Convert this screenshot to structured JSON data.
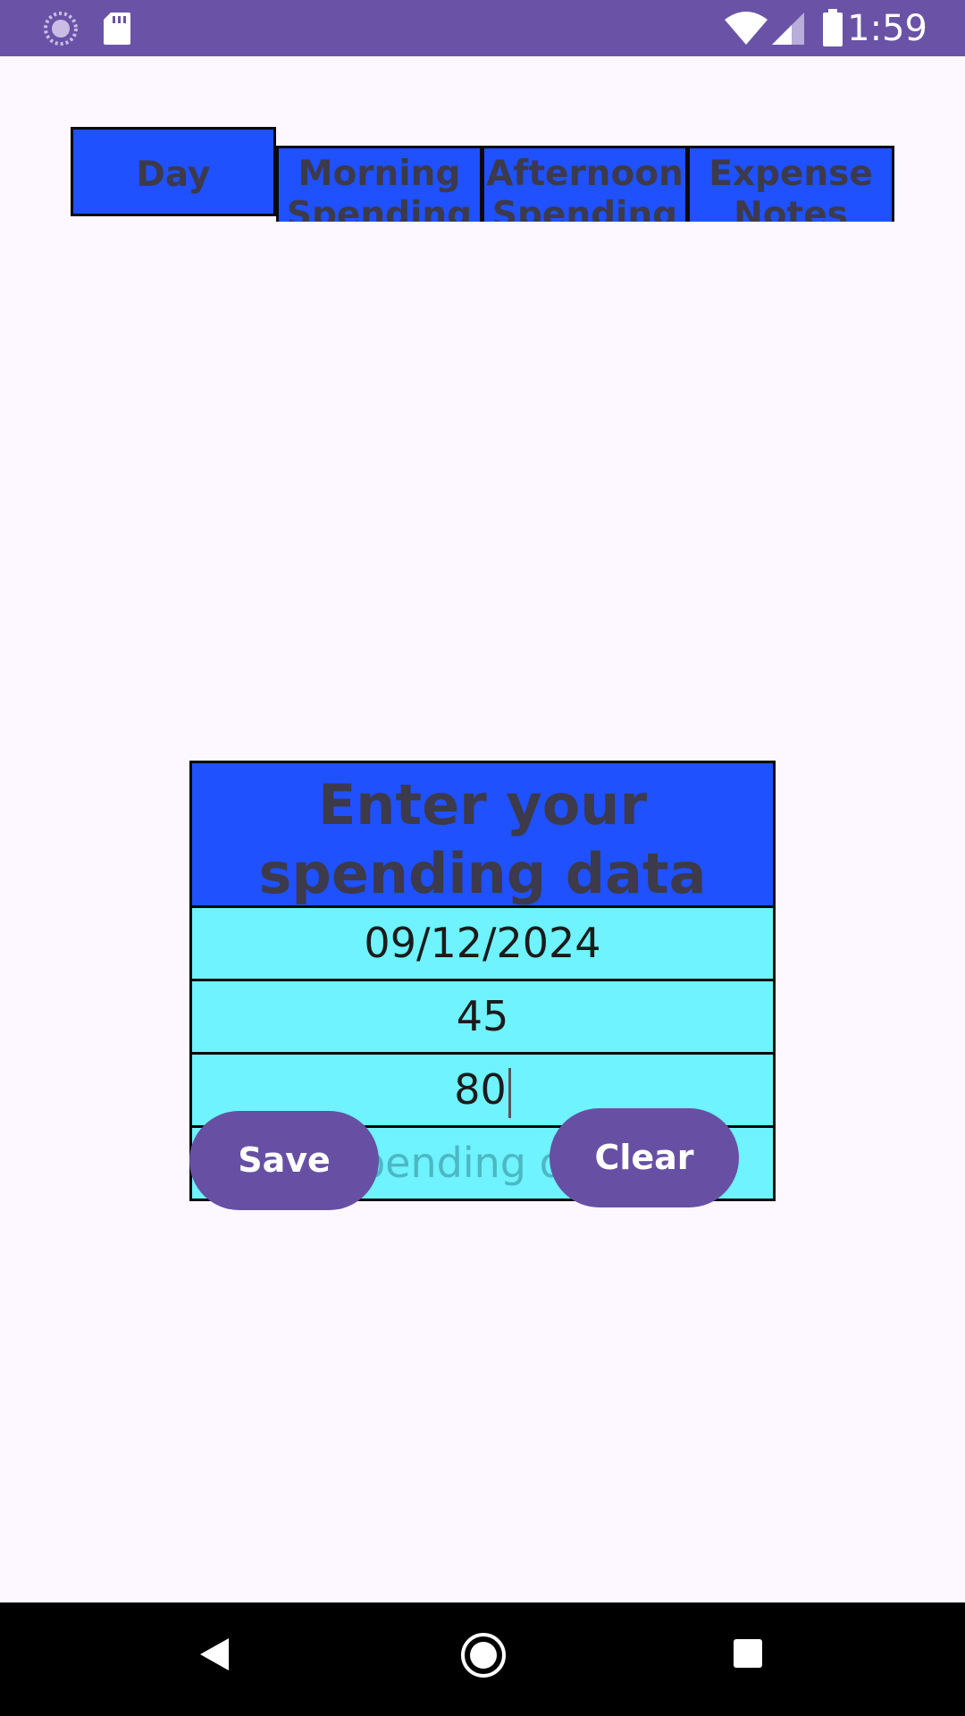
{
  "status_bar": {
    "time": "1:59",
    "icons": [
      "loading-spinner-icon",
      "sd-card-icon",
      "wifi-icon",
      "cell-signal-icon",
      "battery-icon"
    ],
    "color": "#6A53A6"
  },
  "tabs": [
    {
      "label": "Day",
      "selected": true
    },
    {
      "label": "Morning Spending",
      "selected": false
    },
    {
      "label": "Afternoon Spending",
      "selected": false
    },
    {
      "label": "Expense Notes",
      "selected": false
    }
  ],
  "form": {
    "title": "Enter your spending data",
    "fields": {
      "date": {
        "value": "09/12/2024"
      },
      "morning": {
        "value": "45"
      },
      "afternoon": {
        "value": "80"
      },
      "notes": {
        "value": "",
        "placeholder": "Spending data"
      }
    }
  },
  "buttons": {
    "save": "Save",
    "clear": "Clear"
  },
  "nav_bar": {
    "icons": [
      "back-icon",
      "home-icon",
      "recents-icon"
    ]
  },
  "colors": {
    "accent": "#6750A4",
    "tab_blue": "#1F51FF",
    "field_cyan": "#6EF3FF",
    "background": "#FDF7FF"
  }
}
